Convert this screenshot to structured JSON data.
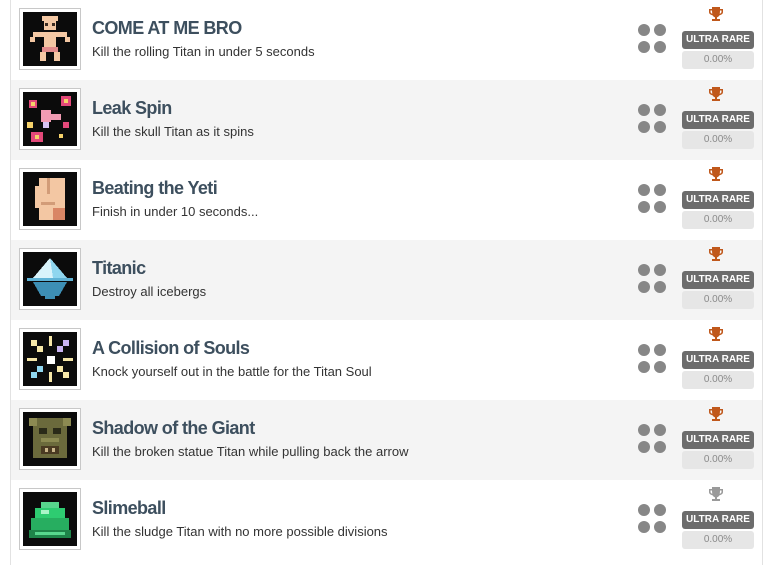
{
  "achievements": [
    {
      "title": "COME AT ME BRO",
      "description": "Kill the rolling Titan in under 5 seconds",
      "icon": "pixel-man-icon",
      "badge": "ULTRA RARE",
      "percent": "0.00%",
      "trophy_color": "#c0581b"
    },
    {
      "title": "Leak Spin",
      "description": "Kill the skull Titan as it spins",
      "icon": "pixel-flowers-icon",
      "badge": "ULTRA RARE",
      "percent": "0.00%",
      "trophy_color": "#c0581b"
    },
    {
      "title": "Beating the Yeti",
      "description": "Finish in under 10 seconds...",
      "icon": "pixel-fist-icon",
      "badge": "ULTRA RARE",
      "percent": "0.00%",
      "trophy_color": "#c0581b"
    },
    {
      "title": "Titanic",
      "description": "Destroy all icebergs",
      "icon": "pixel-iceberg-icon",
      "badge": "ULTRA RARE",
      "percent": "0.00%",
      "trophy_color": "#c0581b"
    },
    {
      "title": "A Collision of Souls",
      "description": "Knock yourself out in the battle for the Titan Soul",
      "icon": "pixel-burst-icon",
      "badge": "ULTRA RARE",
      "percent": "0.00%",
      "trophy_color": "#c0581b"
    },
    {
      "title": "Shadow of the Giant",
      "description": "Kill the broken statue Titan while pulling back the arrow",
      "icon": "pixel-statue-icon",
      "badge": "ULTRA RARE",
      "percent": "0.00%",
      "trophy_color": "#c0581b"
    },
    {
      "title": "Slimeball",
      "description": "Kill the sludge Titan with no more possible divisions",
      "icon": "pixel-slime-icon",
      "badge": "ULTRA RARE",
      "percent": "0.00%",
      "trophy_color": "#9a9a9a"
    }
  ]
}
